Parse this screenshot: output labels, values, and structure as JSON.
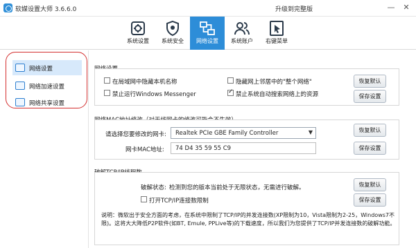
{
  "window": {
    "title": "软媒设置大师 3.6.6.0",
    "upgrade": "升级到完整版",
    "minimize": "—",
    "close": "✕"
  },
  "toolbar": {
    "items": [
      {
        "label": "系统设置",
        "icon": "gear-icon"
      },
      {
        "label": "系统安全",
        "icon": "shield-icon"
      },
      {
        "label": "网络设置",
        "icon": "network-icon",
        "active": true
      },
      {
        "label": "系统账户",
        "icon": "users-icon"
      },
      {
        "label": "右键菜单",
        "icon": "cursor-icon"
      }
    ]
  },
  "sidebar": {
    "items": [
      {
        "label": "网络设置",
        "active": true
      },
      {
        "label": "网络加速设置"
      },
      {
        "label": "网络共享设置"
      }
    ]
  },
  "network": {
    "title": "网络设置",
    "options": [
      {
        "label": "在局域网中隐藏本机名称",
        "checked": false
      },
      {
        "label": "隐藏网上邻居中的\"整个网络\"",
        "checked": false
      },
      {
        "label": "禁止运行Windows Messenger",
        "checked": false
      },
      {
        "label": "禁止系统自动搜索网络上的资源",
        "checked": true
      }
    ],
    "restore_label": "恢复默认",
    "save_label": "保存设置"
  },
  "mac": {
    "title": "网络MAC地址修改（对无线网卡的修改可能会不生效）",
    "select_label": "请选择您要修改的网卡:",
    "select_value": "Realtek PCIe GBE Family Controller",
    "mac_label": "网卡MAC地址:",
    "mac_value": "74 D4 35 59 55 C9",
    "restore_label": "恢复默认",
    "save_label": "保存设置"
  },
  "tcpip": {
    "title": "破解TCP/IP线程数",
    "status_label": "破解状态:",
    "status_value": "检测到您的版本当前处于无限状态，无需进行破解。",
    "open_limit_label": "打开TCP/IP连接数限制",
    "restore_label": "恢复默认",
    "save_label": "保存设置",
    "note": "说明：微软出于安全方面的考虑，在系统中限制了TCP/IP的并发连接数(XP限制为10，Vista限制为2-25，Windows7不限)。这将大大降低P2P软件(如BT, Emule, PPLive等)的下载速度，所以我们为您提供了TCP/IP并发连接数的破解功能。"
  },
  "colors": {
    "accent": "#2d8dd8",
    "highlight": "#d32f2f"
  }
}
